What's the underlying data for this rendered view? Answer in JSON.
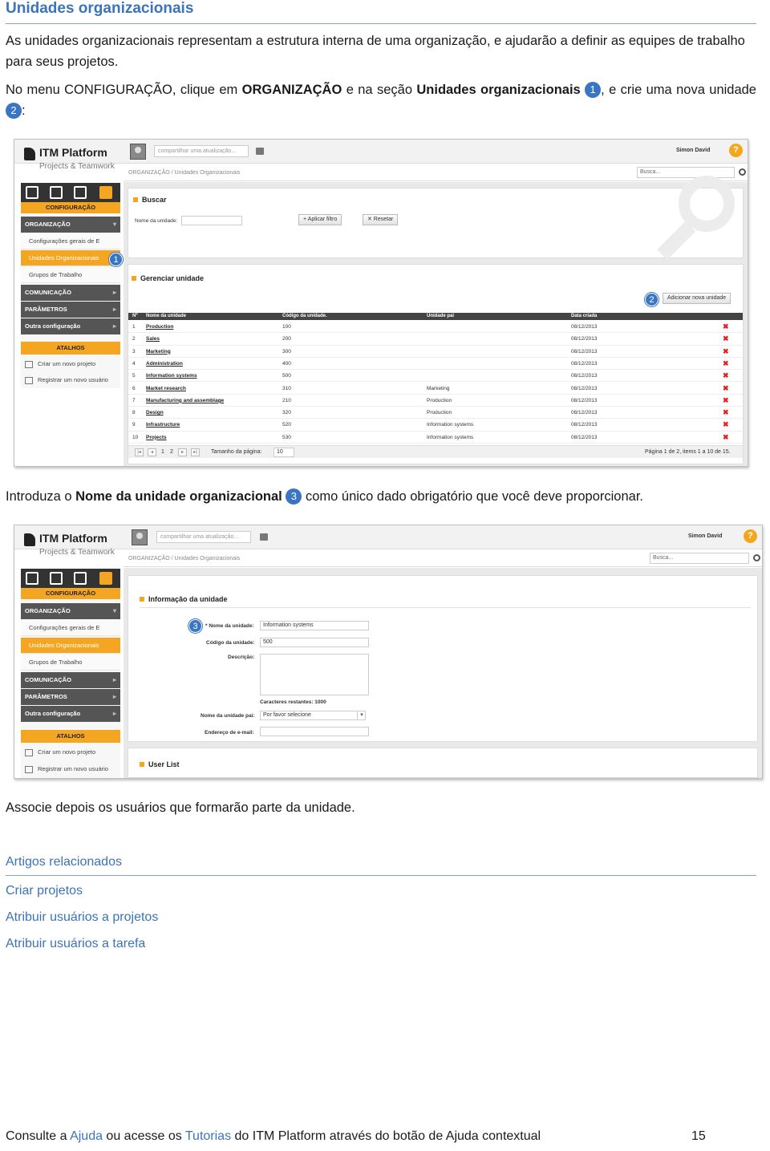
{
  "doc": {
    "title": "Unidades organizacionais",
    "p1": "As unidades organizacionais representam a estrutura interna de uma organização, e ajudarão a definir as equipes de trabalho para seus projetos.",
    "p2_a": "No menu CONFIGURAÇÃO, clique em ",
    "p2_b": "ORGANIZAÇÃO",
    "p2_c": " e na seção ",
    "p2_d": "Unidades organizacionais",
    "p2_e": ", e crie uma nova unidade ",
    "p2_f": ":",
    "n1": "1",
    "n2": "2",
    "n3": "3",
    "p3_a": "Introduza o ",
    "p3_b": "Nome da unidade organizacional",
    "p3_c": " como único dado obrigatório que você deve proporcionar.",
    "p4": "Associe depois os usuários que formarão parte da unidade.",
    "related_title": "Artigos relacionados",
    "related": [
      "Criar projetos",
      "Atribuir usuários a projetos",
      "Atribuir usuários a tarefa"
    ],
    "footer_a": "Consulte a ",
    "footer_b": "Ajuda",
    "footer_c": " ou acesse os ",
    "footer_d": "Tutorias",
    "footer_e": " do ITM Platform através do botão de Ajuda contextual",
    "page_number": "15"
  },
  "app": {
    "logo_name": "ITM Platform",
    "logo_sub": "Projects & Teamwork",
    "share_placeholder": "compartilhar uma atualização...",
    "user": "Simon David",
    "help": "?",
    "breadcrumb": "ORGANIZAÇÃO / Unidades Organizacionais",
    "search": "Busca...",
    "side_config": "CONFIGURAÇÃO",
    "side_org": "ORGANIZAÇÃO",
    "side_items": [
      "Configurações gerais de E",
      "Unidades Organizacionais",
      "Grupos de Trabalho"
    ],
    "side_com": "COMUNICAÇÃO",
    "side_param": "PARÂMETROS",
    "side_other": "Outra configuração",
    "side_shortcuts": "ATALHOS",
    "side_short_items": [
      "Criar um novo projeto",
      "Registrar um novo usuário"
    ]
  },
  "shot1": {
    "search_title": "Buscar",
    "name_label": "Nome da unidade:",
    "apply_btn": "+ Aplicar filtro",
    "reset_btn": "✕ Resetar",
    "manage_title": "Gerenciar unidade",
    "add_btn": "Adicionar nova unidade",
    "columns": [
      "Nº",
      "Nome da unidade",
      "Código da unidade.",
      "Unidade pai",
      "Data criada"
    ],
    "rows": [
      [
        "1",
        "Production",
        "100",
        "",
        "08/12/2013"
      ],
      [
        "2",
        "Sales",
        "200",
        "",
        "08/12/2013"
      ],
      [
        "3",
        "Marketing",
        "300",
        "",
        "08/12/2013"
      ],
      [
        "4",
        "Administration",
        "400",
        "",
        "08/12/2013"
      ],
      [
        "5",
        "Information systems",
        "500",
        "",
        "08/12/2013"
      ],
      [
        "6",
        "Market research",
        "310",
        "Marketing",
        "08/12/2013"
      ],
      [
        "7",
        "Manufacturing and assemblage",
        "210",
        "Production",
        "08/12/2013"
      ],
      [
        "8",
        "Design",
        "320",
        "Production",
        "08/12/2013"
      ],
      [
        "9",
        "Infrastructure",
        "520",
        "Information systems",
        "08/12/2013"
      ],
      [
        "10",
        "Projects",
        "530",
        "Information systems",
        "08/12/2013"
      ]
    ],
    "page1": "1",
    "page2": "2",
    "page_size_label": "Tamanho da página:",
    "page_size": "10",
    "page_info": "Página 1 de 2, items 1 a 10 de 15."
  },
  "shot2": {
    "info_title": "Informação da unidade",
    "name_label": "* Nome da unidade:",
    "name_value": "Information systems",
    "code_label": "Código da unidade:",
    "code_value": "500",
    "desc_label": "Descrição:",
    "chars_left": "Caracteres restantes: 1000",
    "parent_label": "Nome da unidade pai:",
    "parent_value": "Por favor selecione",
    "email_label": "Endereço de e-mail:",
    "user_list": "User List"
  }
}
